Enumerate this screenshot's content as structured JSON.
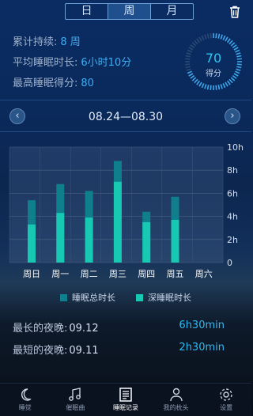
{
  "period_tabs": [
    {
      "label": "日",
      "active": false
    },
    {
      "label": "周",
      "active": true
    },
    {
      "label": "月",
      "active": false
    }
  ],
  "stats": {
    "duration_label": "累计持续:",
    "duration_value": "8 周",
    "avg_sleep_label": "平均睡眠时长:",
    "avg_sleep_value": "6小时10分",
    "best_score_label": "最高睡眠得分:",
    "best_score_value": "80"
  },
  "score": {
    "value": "70",
    "unit": "得分",
    "level": 0.7
  },
  "date_range": "08.24—08.30",
  "chart_data": {
    "type": "bar",
    "categories": [
      "周日",
      "周一",
      "周二",
      "周三",
      "周四",
      "周五",
      "周六"
    ],
    "series": [
      {
        "name": "睡眠总时长",
        "values": [
          5.4,
          6.8,
          6.2,
          8.8,
          4.4,
          5.7,
          0
        ]
      },
      {
        "name": "深睡眠时长",
        "values": [
          3.3,
          4.3,
          3.9,
          7.0,
          3.5,
          3.7,
          0
        ]
      }
    ],
    "y_ticks": [
      "0",
      "2h",
      "4h",
      "6h",
      "8h",
      "10h"
    ],
    "ylim": [
      0,
      10
    ],
    "colors": [
      "#0f7f8e",
      "#17c8b2"
    ],
    "grid": true,
    "legend_position": "bottom"
  },
  "records": {
    "longest_label": "最长的夜晚:",
    "longest_date": "09.12",
    "longest_duration": "6h30min",
    "shortest_label": "最短的夜晚:",
    "shortest_date": "09.11",
    "shortest_duration": "2h30min"
  },
  "tabbar": [
    {
      "label": "睡觉",
      "icon": "moon-icon",
      "active": false
    },
    {
      "label": "催眠曲",
      "icon": "music-note-icon",
      "active": false
    },
    {
      "label": "睡眠记录",
      "icon": "record-icon",
      "active": true
    },
    {
      "label": "我的枕头",
      "icon": "person-icon",
      "active": false
    },
    {
      "label": "设置",
      "icon": "gear-icon",
      "active": false
    }
  ]
}
